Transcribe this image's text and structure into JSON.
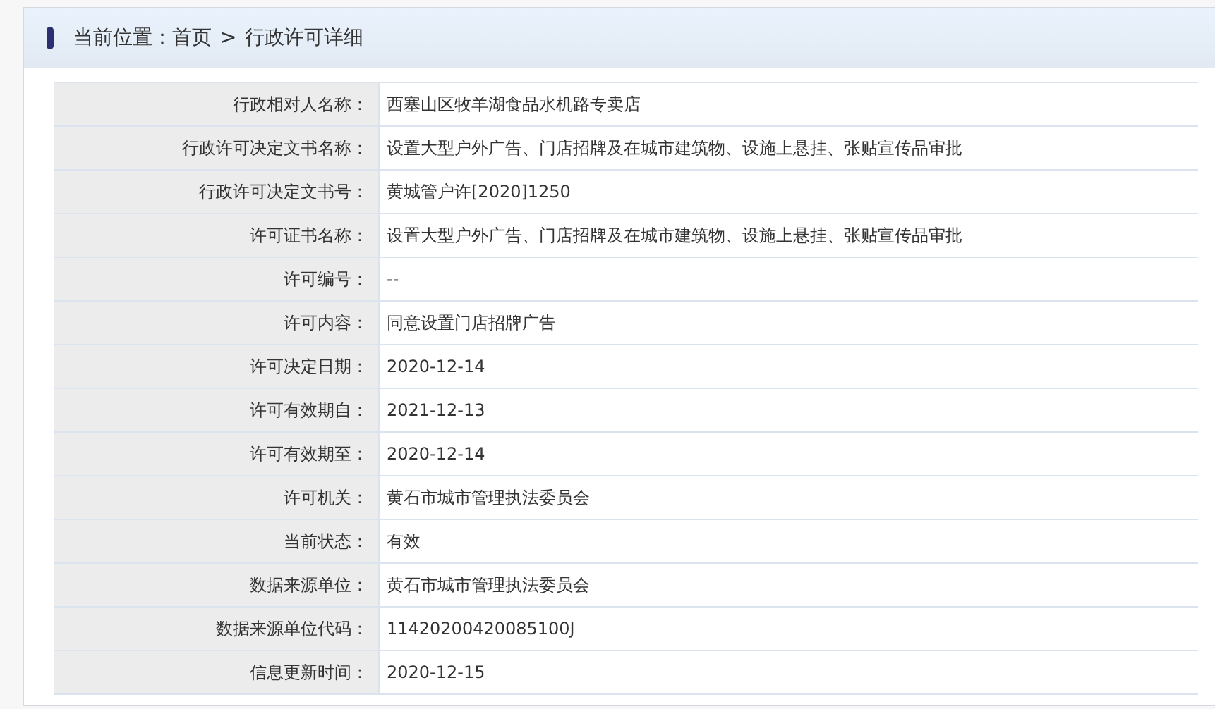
{
  "breadcrumb": {
    "label": "当前位置：",
    "link": "首页",
    "separator": ">",
    "current": "行政许可详细"
  },
  "details": [
    {
      "label": "行政相对人名称：",
      "value": "西塞山区牧羊湖食品水机路专卖店"
    },
    {
      "label": "行政许可决定文书名称：",
      "value": "设置大型户外广告、门店招牌及在城市建筑物、设施上悬挂、张贴宣传品审批"
    },
    {
      "label": "行政许可决定文书号：",
      "value": "黄城管户许[2020]1250"
    },
    {
      "label": "许可证书名称：",
      "value": "设置大型户外广告、门店招牌及在城市建筑物、设施上悬挂、张贴宣传品审批"
    },
    {
      "label": "许可编号：",
      "value": "--"
    },
    {
      "label": "许可内容：",
      "value": "同意设置门店招牌广告"
    },
    {
      "label": "许可决定日期：",
      "value": "2020-12-14"
    },
    {
      "label": "许可有效期自：",
      "value": "2021-12-13"
    },
    {
      "label": "许可有效期至：",
      "value": "2020-12-14"
    },
    {
      "label": "许可机关：",
      "value": "黄石市城市管理执法委员会"
    },
    {
      "label": "当前状态：",
      "value": "有效"
    },
    {
      "label": "数据来源单位：",
      "value": "黄石市城市管理执法委员会"
    },
    {
      "label": "数据来源单位代码：",
      "value": "11420200420085100J"
    },
    {
      "label": "信息更新时间：",
      "value": "2020-12-15"
    }
  ]
}
